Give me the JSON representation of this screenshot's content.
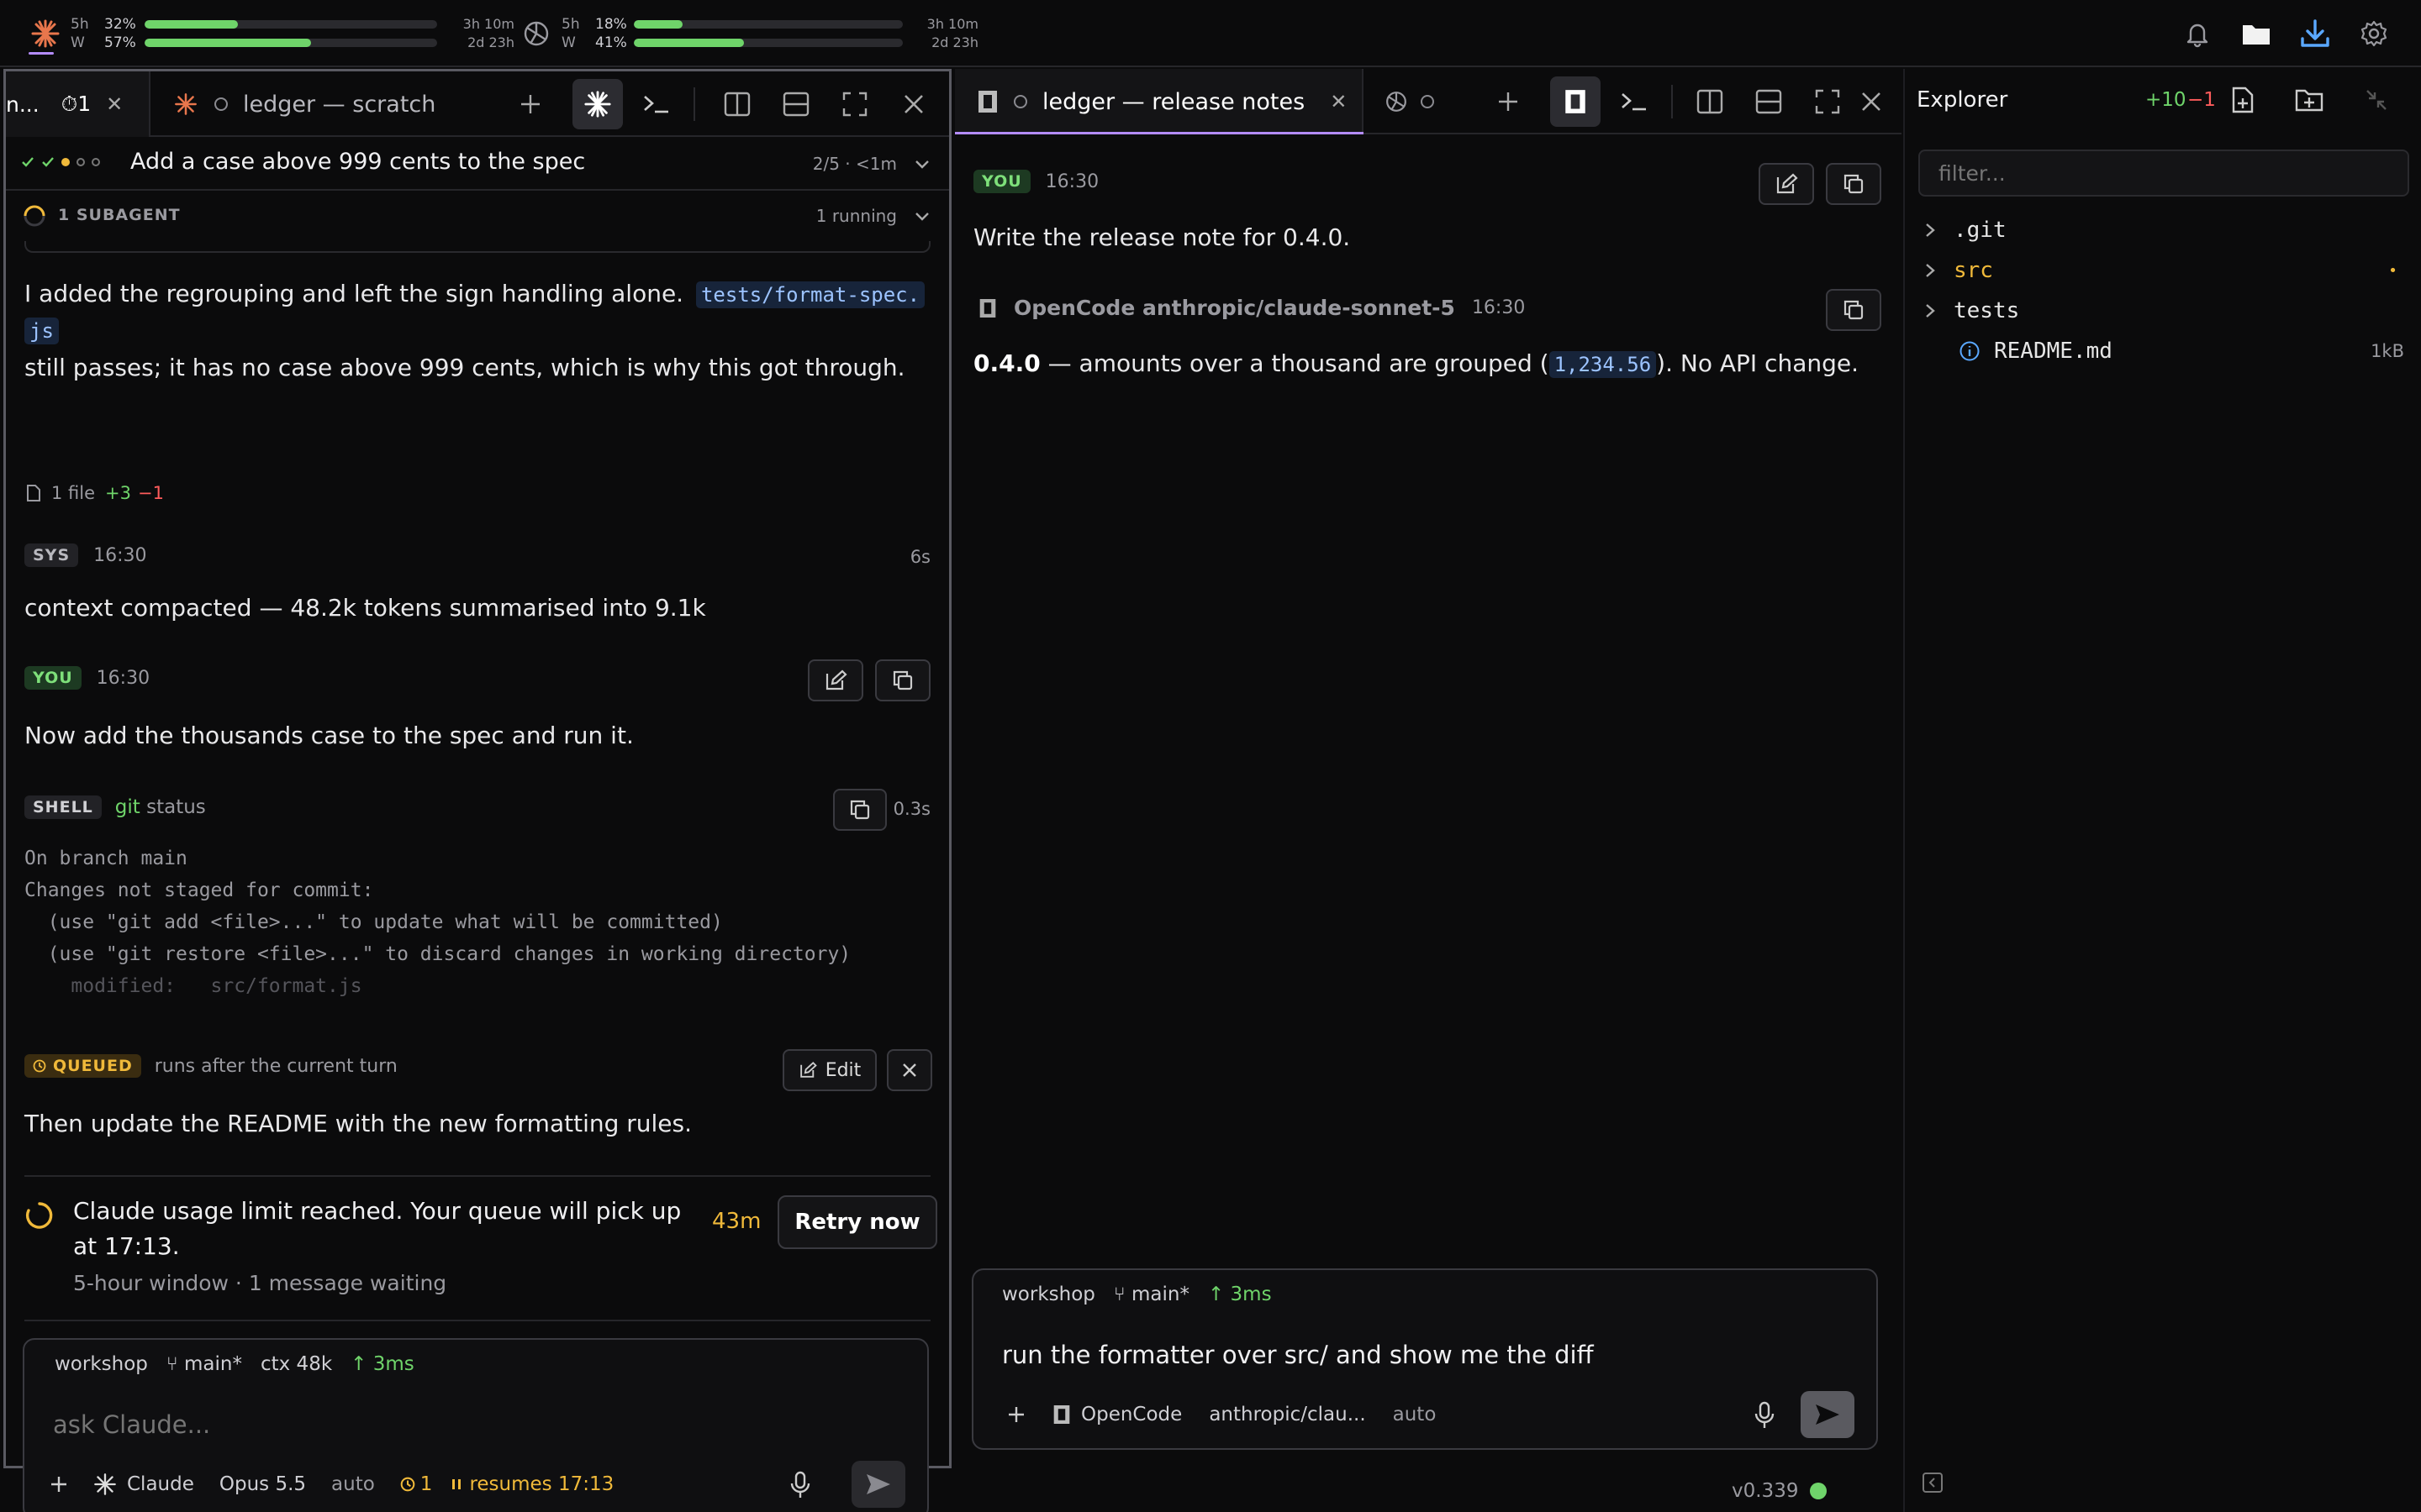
{
  "topbar": {
    "claude_usage": {
      "top_label": "5h",
      "bottom_label": "W",
      "pct_5h": "32%",
      "pct_w": "57%",
      "fill_5h": 0.32,
      "fill_w": 0.57,
      "reset_5h": "3h 10m",
      "reset_w": "2d 23h"
    },
    "openai_usage": {
      "top_label": "5h",
      "bottom_label": "W",
      "pct_5h": "18%",
      "pct_w": "41%",
      "fill_5h": 0.18,
      "fill_w": 0.41,
      "reset_5h": "3h 10m",
      "reset_w": "2d 23h"
    },
    "icons": [
      "bell-icon",
      "folder-icon",
      "download-icon",
      "gear-icon"
    ]
  },
  "pane1": {
    "tabs": [
      {
        "label": "n...",
        "count": "⏱1"
      },
      {
        "label": "ledger — scratch"
      }
    ],
    "task": {
      "title": "Add a case above 999 cents to the spec",
      "progress": "2/5 · <1m"
    },
    "subagent": {
      "label": "1 SUBAGENT",
      "status": "1 running"
    },
    "assistant_msg": {
      "text_before": "I added the regrouping and left the sign handling alone.",
      "code": "tests/format-spec.js",
      "code_part1": "tests/format-spec.",
      "code_part2": "js",
      "text_after": "still passes; it has no case above 999 cents, which is why this got through.",
      "files": "1 file",
      "added": "+3",
      "removed": "−1"
    },
    "sys_msg": {
      "badge": "SYS",
      "time": "16:30",
      "duration": "6s",
      "text": "context compacted — 48.2k tokens summarised into 9.1k"
    },
    "you_msg": {
      "badge": "YOU",
      "time": "16:30",
      "text": "Now add the thousands case to the spec and run it."
    },
    "shell": {
      "badge": "SHELL",
      "cmd_name": "git",
      "cmd_arg": "status",
      "duration": "0.3s",
      "output": [
        "On branch main",
        "Changes not staged for commit:",
        "  (use \"git add <file>...\" to update what will be committed)",
        "  (use \"git restore <file>...\" to discard changes in working directory)",
        "    modified:   src/format.js"
      ]
    },
    "queued": {
      "badge": "QUEUED",
      "note": "runs after the current turn",
      "edit_label": "Edit",
      "text": "Then update the README with the new formatting rules."
    },
    "limit": {
      "title": "Claude usage limit reached. Your queue will pick up",
      "title2": "at 17:13.",
      "countdown": "43m",
      "retry_label": "Retry now",
      "sub": "5-hour window · 1 message waiting"
    },
    "composer": {
      "workspace": "workshop",
      "branch": "⑂ main*",
      "ctx": "ctx 48k",
      "latency": "↑ 3ms",
      "placeholder": "ask Claude...",
      "agent": "Claude",
      "model": "Opus 5.5",
      "mode": "auto",
      "queue_count": "1",
      "resume": "resumes 17:13"
    }
  },
  "pane2": {
    "tabs": [
      {
        "label": "ledger — release notes"
      }
    ],
    "you_msg": {
      "badge": "YOU",
      "time": "16:30",
      "text": "Write the release note for 0.4.0."
    },
    "reply": {
      "agent": "OpenCode anthropic/claude-sonnet-5",
      "time": "16:30",
      "bold": "0.4.0",
      "text1": " — amounts over a thousand are grouped (",
      "code": "1,234.56",
      "text2": "). No API change."
    },
    "composer": {
      "workspace": "workshop",
      "branch": "⑂ main*",
      "latency": "↑ 3ms",
      "value": "run the formatter over src/ and show me the diff",
      "agent": "OpenCode",
      "model": "anthropic/clau...",
      "mode": "auto"
    }
  },
  "explorer": {
    "title": "Explorer",
    "added": "+10",
    "removed": "−1",
    "filter_placeholder": "filter...",
    "items": [
      {
        "name": ".git",
        "type": "folder"
      },
      {
        "name": "src",
        "type": "folder",
        "modified": "•"
      },
      {
        "name": "tests",
        "type": "folder"
      },
      {
        "name": "README.md",
        "type": "file",
        "size": "1kB"
      }
    ]
  },
  "statusbar": {
    "version": "v0.339"
  },
  "colors": {
    "accent_green": "#6fd46a",
    "accent_yellow": "#f0b93a",
    "accent_red": "#ff5c5c",
    "claude_orange": "#e8764c",
    "tab_underline": "#b48cff"
  }
}
